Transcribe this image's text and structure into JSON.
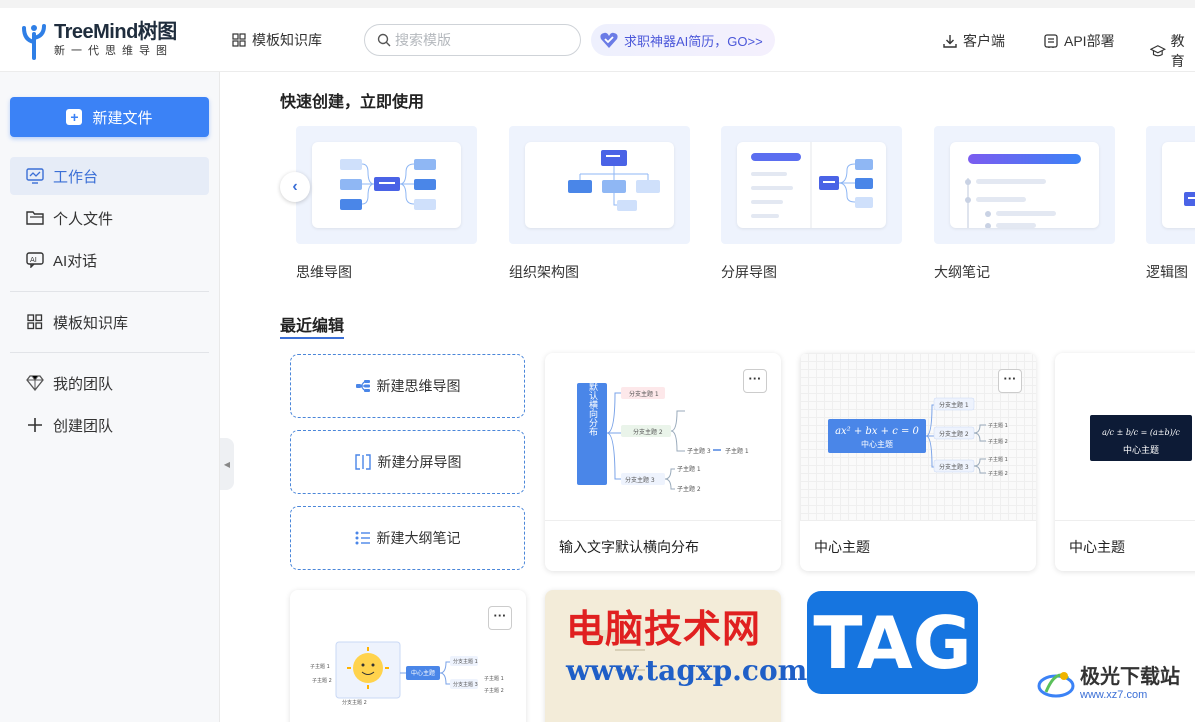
{
  "header": {
    "logo_title": "TreeMind树图",
    "logo_subtitle": "新一代思维导图",
    "nav_templates": "模板知识库",
    "search_placeholder": "搜索模版",
    "promo": "求职神器AI简历，GO>>",
    "client": "客户端",
    "api": "API部署",
    "edu": "教育"
  },
  "sidebar": {
    "new_file": "新建文件",
    "items": [
      {
        "label": "工作台",
        "icon": "monitor-icon"
      },
      {
        "label": "个人文件",
        "icon": "folder-icon"
      },
      {
        "label": "AI对话",
        "icon": "ai-chat-icon"
      },
      {
        "label": "模板知识库",
        "icon": "grid-icon"
      },
      {
        "label": "我的团队",
        "icon": "diamond-icon"
      },
      {
        "label": "创建团队",
        "icon": "plus-icon"
      }
    ]
  },
  "quick_create": {
    "title": "快速创建，立即使用",
    "cards": [
      "思维导图",
      "组织架构图",
      "分屏导图",
      "大纲笔记",
      "逻辑图"
    ]
  },
  "recent": {
    "title": "最近编辑",
    "new_buttons": [
      "新建思维导图",
      "新建分屏导图",
      "新建大纲笔记"
    ],
    "files": [
      {
        "name": "输入文字默认横向分布"
      },
      {
        "name": "中心主题"
      },
      {
        "name": "中心主题"
      }
    ],
    "more_label": "···"
  },
  "thumb_text": {
    "vertical_root": "输入文字默认横向分布",
    "branch": "分支主题",
    "branch_1": "分支主题 1",
    "branch_2": "分支主题 2",
    "branch_3": "分支主题 3",
    "sub": "子主题",
    "sub_1": "子主题 1",
    "sub_2": "子主题 2",
    "sub_3": "子主题 3",
    "center": "中心主题",
    "formula1": "ax² + bx + c = 0",
    "formula2": "a/c ± b/c = (a±b)/c"
  },
  "watermarks": {
    "site_cn": "电脑技术网",
    "site_url": "www.tagxp.com",
    "tag": "TAG",
    "brand_cn": "极光下载站",
    "brand_url": "www.xz7.com"
  },
  "colors": {
    "primary": "#3b82f6",
    "active_text": "#3b6fd6",
    "card_bg": "#eef3fd"
  }
}
